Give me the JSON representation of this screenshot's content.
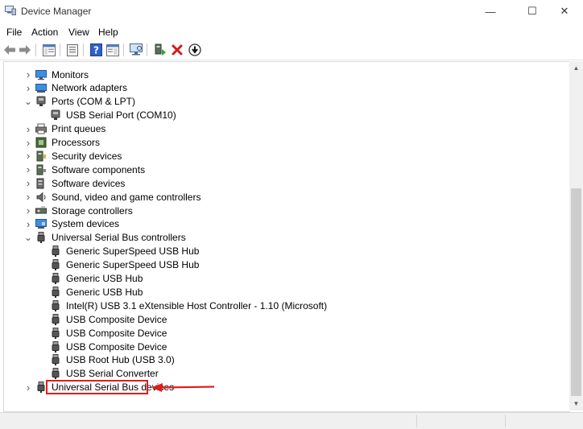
{
  "window": {
    "title": "Device Manager",
    "minimize_glyph": "—",
    "maximize_glyph": "☐",
    "close_glyph": "✕"
  },
  "menu": [
    "File",
    "Action",
    "View",
    "Help"
  ],
  "tree": [
    {
      "label": "Monitors",
      "level": 0,
      "state": "collapsed",
      "icon": "monitor-icon"
    },
    {
      "label": "Network adapters",
      "level": 0,
      "state": "collapsed",
      "icon": "network-adapter-icon"
    },
    {
      "label": "Ports (COM & LPT)",
      "level": 0,
      "state": "expanded",
      "icon": "port-icon"
    },
    {
      "label": "USB Serial Port (COM10)",
      "level": 1,
      "state": "leaf",
      "icon": "port-icon"
    },
    {
      "label": "Print queues",
      "level": 0,
      "state": "collapsed",
      "icon": "printer-icon"
    },
    {
      "label": "Processors",
      "level": 0,
      "state": "collapsed",
      "icon": "processor-icon"
    },
    {
      "label": "Security devices",
      "level": 0,
      "state": "collapsed",
      "icon": "security-device-icon"
    },
    {
      "label": "Software components",
      "level": 0,
      "state": "collapsed",
      "icon": "software-component-icon"
    },
    {
      "label": "Software devices",
      "level": 0,
      "state": "collapsed",
      "icon": "software-device-icon"
    },
    {
      "label": "Sound, video and game controllers",
      "level": 0,
      "state": "collapsed",
      "icon": "speaker-icon"
    },
    {
      "label": "Storage controllers",
      "level": 0,
      "state": "collapsed",
      "icon": "storage-controller-icon"
    },
    {
      "label": "System devices",
      "level": 0,
      "state": "collapsed",
      "icon": "system-device-icon"
    },
    {
      "label": "Universal Serial Bus controllers",
      "level": 0,
      "state": "expanded",
      "icon": "usb-icon"
    },
    {
      "label": "Generic SuperSpeed USB Hub",
      "level": 1,
      "state": "leaf",
      "icon": "usb-icon"
    },
    {
      "label": "Generic SuperSpeed USB Hub",
      "level": 1,
      "state": "leaf",
      "icon": "usb-icon"
    },
    {
      "label": "Generic USB Hub",
      "level": 1,
      "state": "leaf",
      "icon": "usb-icon"
    },
    {
      "label": "Generic USB Hub",
      "level": 1,
      "state": "leaf",
      "icon": "usb-icon"
    },
    {
      "label": "Intel(R) USB 3.1 eXtensible Host Controller - 1.10 (Microsoft)",
      "level": 1,
      "state": "leaf",
      "icon": "usb-icon"
    },
    {
      "label": "USB Composite Device",
      "level": 1,
      "state": "leaf",
      "icon": "usb-icon"
    },
    {
      "label": "USB Composite Device",
      "level": 1,
      "state": "leaf",
      "icon": "usb-icon"
    },
    {
      "label": "USB Composite Device",
      "level": 1,
      "state": "leaf",
      "icon": "usb-icon"
    },
    {
      "label": "USB Root Hub (USB 3.0)",
      "level": 1,
      "state": "leaf",
      "icon": "usb-icon"
    },
    {
      "label": "USB Serial Converter",
      "level": 1,
      "state": "leaf",
      "icon": "usb-icon",
      "highlighted": true
    },
    {
      "label": "Universal Serial Bus devices",
      "level": 0,
      "state": "collapsed",
      "icon": "usb-icon"
    }
  ],
  "colors": {
    "highlight": "#e01c1c",
    "uninstall_x": "#d11c1c",
    "help_blue": "#2f62c7"
  }
}
